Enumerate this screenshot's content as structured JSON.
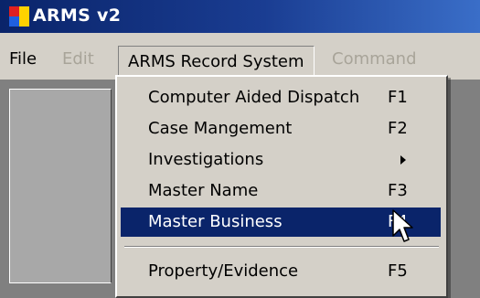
{
  "window": {
    "title": "ARMS v2"
  },
  "menubar": {
    "items": [
      {
        "label": "File",
        "enabled": true
      },
      {
        "label": "Edit",
        "enabled": false
      },
      {
        "label": "ARMS Record System",
        "enabled": true,
        "open": true
      },
      {
        "label": "Command",
        "enabled": false
      }
    ]
  },
  "dropdown": {
    "items": [
      {
        "label": "Computer Aided Dispatch",
        "shortcut": "F1"
      },
      {
        "label": "Case Mangement",
        "shortcut": "F2"
      },
      {
        "label": "Investigations",
        "shortcut": "",
        "submenu": true
      },
      {
        "label": "Master Name",
        "shortcut": "F3"
      },
      {
        "label": "Master Business",
        "shortcut": "F4",
        "selected": true
      },
      {
        "label": "Property/Evidence",
        "shortcut": "F5"
      }
    ]
  },
  "colors": {
    "titlebar": "#0a246a",
    "selection": "#0a246a",
    "menu_bg": "#d4d0c8",
    "client_bg": "#808080"
  },
  "icons": [
    "app-icon",
    "submenu-arrow-icon",
    "mouse-pointer-icon"
  ]
}
